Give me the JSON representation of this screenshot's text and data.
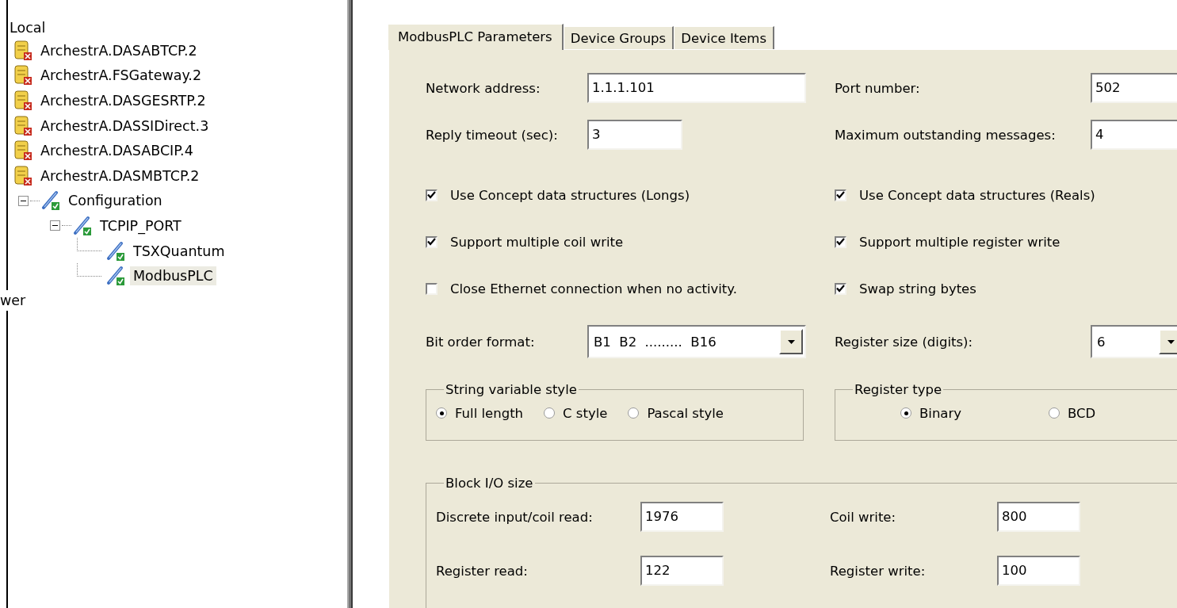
{
  "tree": {
    "root_label": "Local",
    "items": [
      {
        "label": "ArchestrA.DASABTCP.2",
        "kind": "server",
        "selected": false
      },
      {
        "label": "ArchestrA.FSGateway.2",
        "kind": "server",
        "selected": false
      },
      {
        "label": "ArchestrA.DASGESRTP.2",
        "kind": "server",
        "selected": false
      },
      {
        "label": "ArchestrA.DASSIDirect.3",
        "kind": "server",
        "selected": false
      },
      {
        "label": "ArchestrA.DASABCIP.4",
        "kind": "server",
        "selected": false
      },
      {
        "label": "ArchestrA.DASMBTCP.2",
        "kind": "server",
        "selected": false
      },
      {
        "label": "Configuration",
        "kind": "device",
        "selected": false,
        "expanded": true,
        "children": [
          {
            "label": "TCPIP_PORT",
            "kind": "device",
            "selected": false,
            "expanded": true,
            "children": [
              {
                "label": "TSXQuantum",
                "kind": "device",
                "selected": false
              },
              {
                "label": "ModbusPLC",
                "kind": "device",
                "selected": true
              }
            ]
          }
        ]
      }
    ],
    "footer": "wer"
  },
  "tabs": [
    {
      "label": "ModbusPLC Parameters",
      "selected": true
    },
    {
      "label": "Device Groups",
      "selected": false
    },
    {
      "label": "Device Items",
      "selected": false
    }
  ],
  "connection": [
    {
      "label": "Network address:",
      "value": "1.1.1.101"
    },
    {
      "label": "Port number:",
      "value": "502"
    },
    {
      "label": "Reply timeout (sec):",
      "value": "3"
    },
    {
      "label": "Maximum outstanding messages:",
      "value": "4"
    }
  ],
  "options": [
    {
      "label": "Use Concept data structures (Longs)",
      "checked": true
    },
    {
      "label": "Use Concept data structures (Reals)",
      "checked": true
    },
    {
      "label": "Support multiple coil write",
      "checked": true
    },
    {
      "label": "Support multiple register write",
      "checked": true
    },
    {
      "label": "Close Ethernet connection when no activity.",
      "checked": false
    },
    {
      "label": "Swap string bytes",
      "checked": true
    }
  ],
  "formats": [
    {
      "label": "Bit order format:",
      "value": "B1  B2  .........  B16"
    },
    {
      "label": "Register size (digits):",
      "value": "6"
    }
  ],
  "string_variable_style": {
    "title": "String variable style",
    "options": [
      {
        "label": "Full length",
        "selected": true
      },
      {
        "label": "C style",
        "selected": false
      },
      {
        "label": "Pascal style",
        "selected": false
      }
    ]
  },
  "register_type": {
    "title": "Register type",
    "options": [
      {
        "label": "Binary",
        "selected": true
      },
      {
        "label": "BCD",
        "selected": false
      }
    ]
  },
  "block_io_size": {
    "title": "Block I/O size",
    "fields": [
      {
        "label": "Discrete input/coil read:",
        "value": "1976"
      },
      {
        "label": "Coil write:",
        "value": "800"
      },
      {
        "label": "Register read:",
        "value": "122"
      },
      {
        "label": "Register write:",
        "value": "100"
      }
    ]
  }
}
